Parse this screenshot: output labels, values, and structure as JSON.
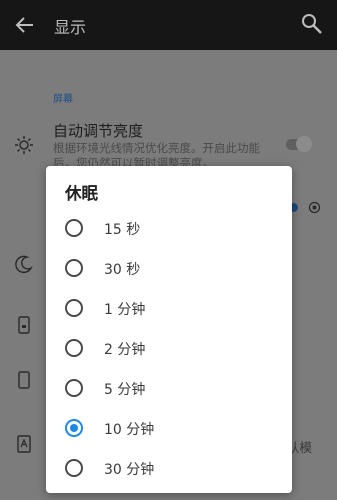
{
  "appbar": {
    "title": "显示"
  },
  "settings": {
    "section_label": "屏幕",
    "auto_brightness": {
      "title": "自动调节亮度",
      "description": "根据环境光线情况优化亮度。开启此功能后，您仍然可以暂时调整亮度。"
    },
    "partial_text": "认模"
  },
  "dialog": {
    "title": "休眠",
    "options": [
      {
        "label": "15 秒",
        "checked": false
      },
      {
        "label": "30 秒",
        "checked": false
      },
      {
        "label": "1 分钟",
        "checked": false
      },
      {
        "label": "2 分钟",
        "checked": false
      },
      {
        "label": "5 分钟",
        "checked": false
      },
      {
        "label": "10 分钟",
        "checked": true
      },
      {
        "label": "30 分钟",
        "checked": false
      }
    ]
  },
  "colors": {
    "accent": "#1e88e5",
    "appbar": "#161616"
  }
}
